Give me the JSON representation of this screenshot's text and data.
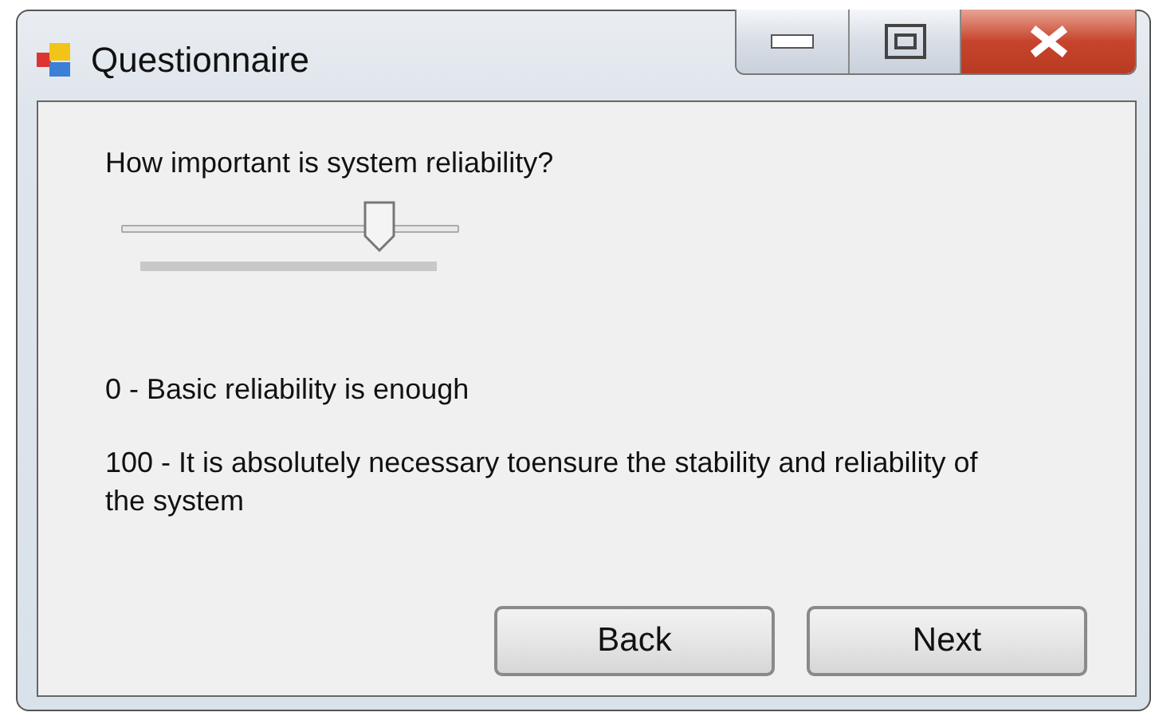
{
  "window": {
    "title": "Questionnaire"
  },
  "question": "How important is system reliability?",
  "slider": {
    "level": 0.8
  },
  "scale_labels": [
    "0 - Basic reliability is enough",
    "100 - It is absolutely necessary toensure the stability and reliability of the system"
  ],
  "buttons": [
    {
      "label": "Back"
    },
    {
      "label": "Next"
    }
  ]
}
